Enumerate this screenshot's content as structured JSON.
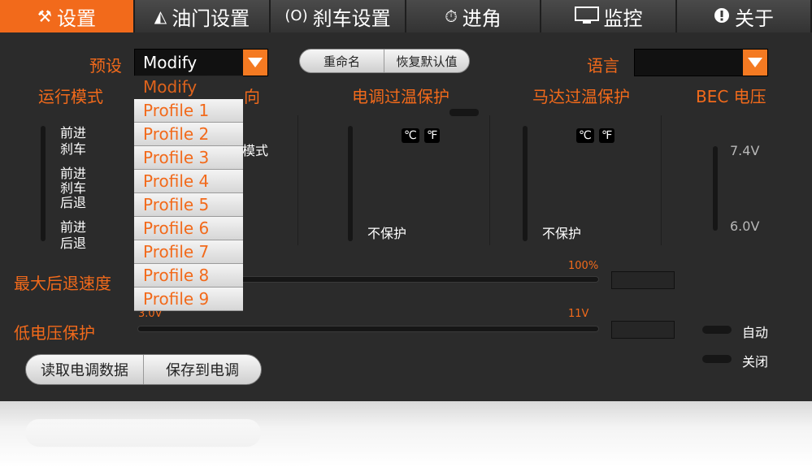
{
  "tabs": [
    {
      "label": "设置",
      "icon": "tools-icon",
      "glyph": "⚒",
      "active": true
    },
    {
      "label": "油门设置",
      "icon": "pedal-icon",
      "glyph": "◭",
      "active": false
    },
    {
      "label": "刹车设置",
      "icon": "brake-icon",
      "glyph": "(O)",
      "active": false
    },
    {
      "label": "进角",
      "icon": "timer-icon",
      "glyph": "⏱",
      "active": false
    },
    {
      "label": "监控",
      "icon": "monitor-icon",
      "glyph": "▭",
      "active": false
    },
    {
      "label": "关于",
      "icon": "info-icon",
      "glyph": "●",
      "active": false
    }
  ],
  "preset": {
    "label": "预设",
    "value": "Modify",
    "options": [
      "Modify",
      "Profile 1",
      "Profile 2",
      "Profile 3",
      "Profile 4",
      "Profile 5",
      "Profile 6",
      "Profile 7",
      "Profile 8",
      "Profile 9"
    ],
    "selected_index": 0
  },
  "preset_buttons": {
    "rename": "重命名",
    "restore": "恢复默认值"
  },
  "language": {
    "label": "语言",
    "value": ""
  },
  "sections": {
    "run_mode": "运行模式",
    "direction": "向",
    "esc_overheat": "电调过温保护",
    "motor_overheat": "马达过温保护",
    "bec_voltage": "BEC 电压"
  },
  "run_mode_options": [
    {
      "line1": "前进",
      "line2": "刹车",
      "line3": ""
    },
    {
      "line1": "前进",
      "line2": "刹车",
      "line3": "后退"
    },
    {
      "line1": "前进",
      "line2": "后退",
      "line3": ""
    }
  ],
  "direction_text": "模式",
  "esc_units": [
    "℃",
    "℉"
  ],
  "motor_units": [
    "℃",
    "℉"
  ],
  "esc_no_protect": "不保护",
  "motor_no_protect": "不保护",
  "bec_values": {
    "high": "7.4V",
    "low": "6.0V"
  },
  "max_reverse": {
    "label": "最大后退速度",
    "max": "100%"
  },
  "low_voltage": {
    "label": "低电压保护",
    "min": "3.0V",
    "max": "11V"
  },
  "auto_off": {
    "auto": "自动",
    "off": "关闭"
  },
  "esc_buttons": {
    "read": "读取电调数据",
    "save": "保存到电调"
  },
  "colors": {
    "accent": "#f26a1b",
    "background": "#2b2b2b"
  }
}
